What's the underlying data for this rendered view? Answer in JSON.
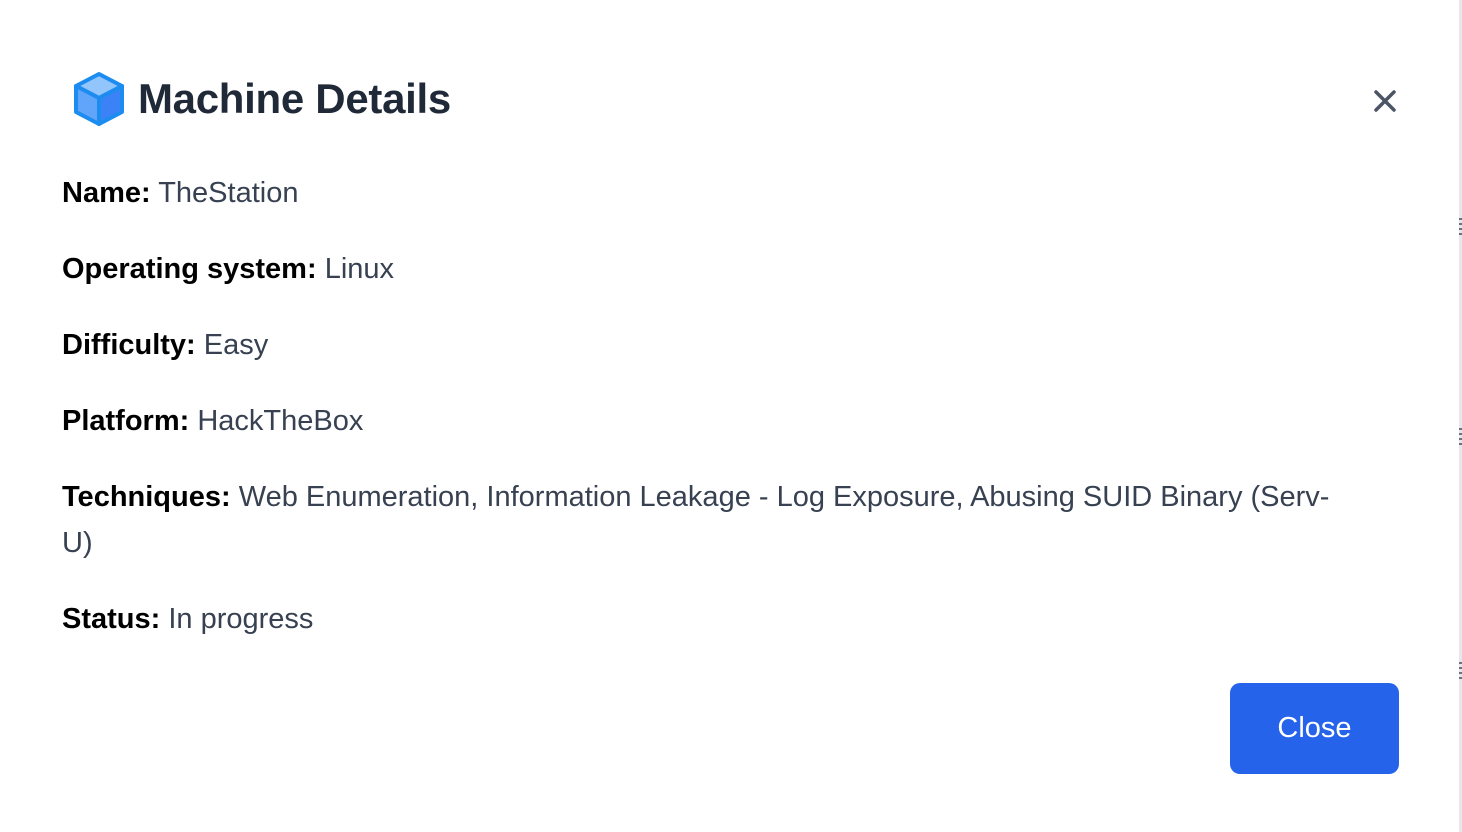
{
  "modal": {
    "title": "Machine Details",
    "icon": "cube-icon",
    "close_icon": "close-icon",
    "accent_color": "#2563eb"
  },
  "details": [
    {
      "label": "Name:",
      "value": "TheStation"
    },
    {
      "label": "Operating system:",
      "value": "Linux"
    },
    {
      "label": "Difficulty:",
      "value": "Easy"
    },
    {
      "label": "Platform:",
      "value": "HackTheBox"
    },
    {
      "label": "Techniques:",
      "value": "Web Enumeration, Information Leakage - Log Exposure, Abusing SUID Binary (Serv-U)"
    },
    {
      "label": "Status:",
      "value": "In progress"
    }
  ],
  "footer": {
    "close_label": "Close"
  }
}
